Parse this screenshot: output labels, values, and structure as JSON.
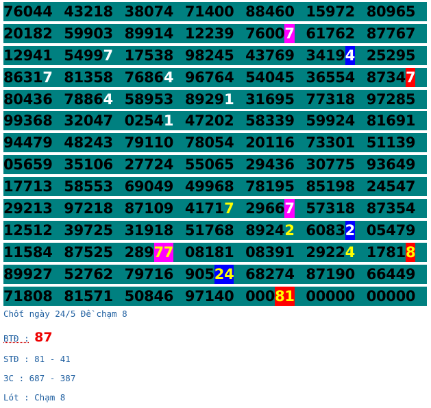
{
  "grid": {
    "rows": [
      [
        [
          "76044"
        ],
        [
          "43218"
        ],
        [
          "38074"
        ],
        [
          "71400"
        ],
        [
          "88460"
        ],
        [
          "15972"
        ],
        [
          "80965"
        ]
      ],
      [
        [
          "20182"
        ],
        [
          "59903"
        ],
        [
          "89914"
        ],
        [
          "12239"
        ],
        [
          "7600",
          "7",
          "mag"
        ],
        [
          "61762"
        ],
        [
          "87767"
        ]
      ],
      [
        [
          "12941"
        ],
        [
          "5499",
          "7",
          "white"
        ],
        [
          "17538"
        ],
        [
          "98245"
        ],
        [
          "43769"
        ],
        [
          "3419",
          "4",
          "blue"
        ],
        [
          "25295"
        ]
      ],
      [
        [
          "8631",
          "7",
          "white"
        ],
        [
          "81358"
        ],
        [
          "7686",
          "4",
          "white"
        ],
        [
          "96764"
        ],
        [
          "54045"
        ],
        [
          "36554"
        ],
        [
          "8734",
          "7",
          "red"
        ]
      ],
      [
        [
          "80436"
        ],
        [
          "7886",
          "4",
          "white"
        ],
        [
          "58953"
        ],
        [
          "8929",
          "1",
          "white"
        ],
        [
          "31695"
        ],
        [
          "77318"
        ],
        [
          "97285"
        ]
      ],
      [
        [
          "99368"
        ],
        [
          "32047"
        ],
        [
          "0254",
          "1",
          "white"
        ],
        [
          "47202"
        ],
        [
          "58339"
        ],
        [
          "59924"
        ],
        [
          "81691"
        ]
      ],
      [
        [
          "94479"
        ],
        [
          "48243"
        ],
        [
          "79110"
        ],
        [
          "78054"
        ],
        [
          "20116"
        ],
        [
          "73301"
        ],
        [
          "51139"
        ]
      ],
      [
        [
          "05659"
        ],
        [
          "35106"
        ],
        [
          "27724"
        ],
        [
          "55065"
        ],
        [
          "29436"
        ],
        [
          "30775"
        ],
        [
          "93649"
        ]
      ],
      [
        [
          "17713"
        ],
        [
          "58553"
        ],
        [
          "69049"
        ],
        [
          "49968"
        ],
        [
          "78195"
        ],
        [
          "85198"
        ],
        [
          "24547"
        ]
      ],
      [
        [
          "29213"
        ],
        [
          "97218"
        ],
        [
          "87109"
        ],
        [
          "4171",
          "7",
          "yellow"
        ],
        [
          "2966",
          "7",
          "mag"
        ],
        [
          "57318"
        ],
        [
          "87354"
        ]
      ],
      [
        [
          "12512"
        ],
        [
          "39725"
        ],
        [
          "31918"
        ],
        [
          "51768"
        ],
        [
          "8924",
          "2",
          "yellow"
        ],
        [
          "6083",
          "2",
          "blue"
        ],
        [
          "05479"
        ]
      ],
      [
        [
          "11584"
        ],
        [
          "87525"
        ],
        [
          "289",
          "77",
          "mag-y"
        ],
        [
          "08181"
        ],
        [
          "08391"
        ],
        [
          "2922",
          "4",
          "yellow"
        ],
        [
          "1781",
          "8",
          "red-y"
        ]
      ],
      [
        [
          "89927"
        ],
        [
          "52762"
        ],
        [
          "79716"
        ],
        [
          "905",
          "24",
          "blue-y"
        ],
        [
          "68274"
        ],
        [
          "87190"
        ],
        [
          "66449"
        ]
      ],
      [
        [
          "71808"
        ],
        [
          "81571"
        ],
        [
          "50846"
        ],
        [
          "97140"
        ],
        [
          "000",
          "81",
          "red-y"
        ],
        [
          "00000"
        ],
        [
          "00000"
        ]
      ]
    ]
  },
  "notes": {
    "line1": "Chốt ngày 24/5 Đề chạm 8",
    "btd_label": "BTĐ :",
    "btd_value": "87",
    "std": "STĐ : 81 - 41",
    "c3": "3C : 687 - 387",
    "lot": "Lót : Chạm 8"
  }
}
